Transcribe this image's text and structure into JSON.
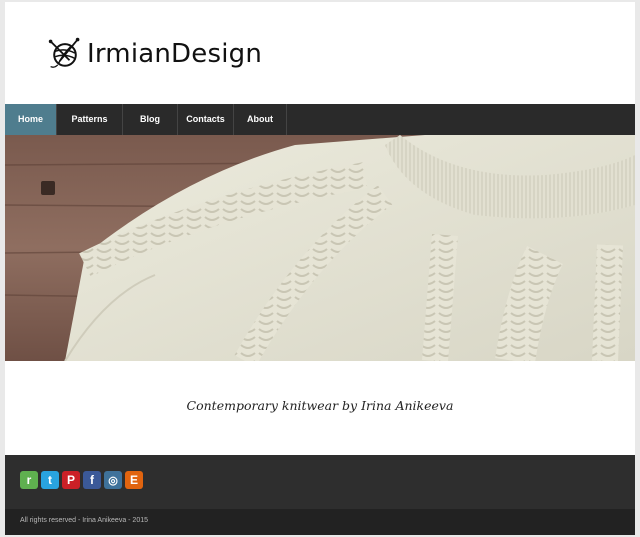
{
  "brand": {
    "name": "IrmianDesign",
    "logo_icon": "yarn-ball-icon"
  },
  "nav": {
    "items": [
      {
        "label": "Home",
        "active": true
      },
      {
        "label": "Patterns",
        "active": false
      },
      {
        "label": "Blog",
        "active": false
      },
      {
        "label": "Contacts",
        "active": false
      },
      {
        "label": "About",
        "active": false
      }
    ],
    "active_color": "#4f7d8e"
  },
  "hero": {
    "image": "cream cable-knit sweater on wooden table"
  },
  "tagline": "Contemporary knitwear by Irina Anikeeva",
  "footer": {
    "social": [
      {
        "name": "ravelry-icon",
        "glyph": "r",
        "color": "#5fb04f"
      },
      {
        "name": "twitter-icon",
        "glyph": "t",
        "color": "#29a3df"
      },
      {
        "name": "pinterest-icon",
        "glyph": "P",
        "color": "#cb2027"
      },
      {
        "name": "facebook-icon",
        "glyph": "f",
        "color": "#3b5998"
      },
      {
        "name": "instagram-icon",
        "glyph": "◎",
        "color": "#3f729b"
      },
      {
        "name": "etsy-icon",
        "glyph": "E",
        "color": "#e1640f"
      }
    ],
    "copyright": "All rights reserved - Irina Anikeeva - 2015"
  }
}
